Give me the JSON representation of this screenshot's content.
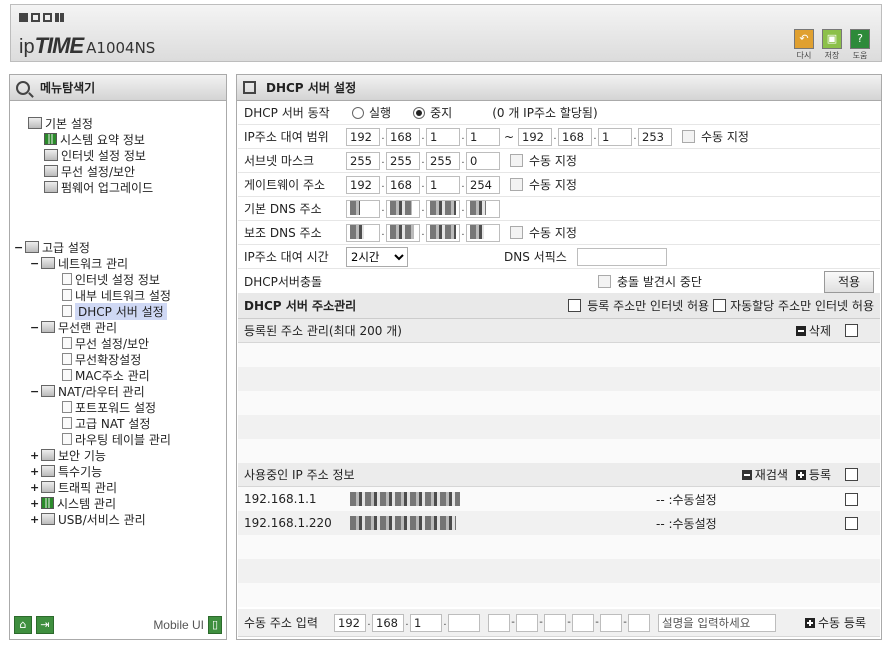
{
  "header": {
    "logo_ip": "ip",
    "logo_time": "TIME",
    "model": "A1004NS",
    "tools": [
      {
        "label": "다시",
        "icon": "undo-icon",
        "color": "#e0a030"
      },
      {
        "label": "저장",
        "icon": "save-icon",
        "color": "#8cc04a"
      },
      {
        "label": "도움",
        "icon": "help-icon",
        "color": "#2d8a3a"
      }
    ]
  },
  "sidebar": {
    "title": "메뉴탐색기",
    "basic": {
      "label": "기본 설정",
      "items": [
        "시스템 요약 정보",
        "인터넷 설정 정보",
        "무선 설정/보안",
        "펌웨어 업그레이드"
      ]
    },
    "advanced": {
      "label": "고급 설정",
      "network": {
        "label": "네트워크 관리",
        "items": [
          "인터넷 설정 정보",
          "내부 네트워크 설정",
          "DHCP 서버 설정"
        ]
      },
      "wireless": {
        "label": "무선랜 관리",
        "items": [
          "무선 설정/보안",
          "무선확장설정",
          "MAC주소 관리"
        ]
      },
      "nat": {
        "label": "NAT/라우터 관리",
        "items": [
          "포트포워드 설정",
          "고급 NAT 설정",
          "라우팅 테이블 관리"
        ]
      },
      "others": [
        "보안 기능",
        "특수기능",
        "트래픽 관리",
        "시스템 관리",
        "USB/서비스 관리"
      ]
    },
    "mobile_label": "Mobile UI"
  },
  "main": {
    "title": "DHCP 서버 설정",
    "server_mode": {
      "label": "DHCP 서버 동작",
      "run": "실행",
      "stop": "중지",
      "note": "(0 개 IP주소 할당됨)",
      "selected": "stop"
    },
    "lease_range": {
      "label": "IP주소 대여 범위",
      "start": [
        "192",
        "168",
        "1",
        "1"
      ],
      "end": [
        "192",
        "168",
        "1",
        "253"
      ],
      "separator": "~",
      "manual": "수동 지정"
    },
    "subnet": {
      "label": "서브넷 마스크",
      "value": [
        "255",
        "255",
        "255",
        "0"
      ],
      "manual": "수동 지정"
    },
    "gateway": {
      "label": "게이트웨이 주소",
      "value": [
        "192",
        "168",
        "1",
        "254"
      ],
      "manual": "수동 지정"
    },
    "dns1": {
      "label": "기본 DNS 주소"
    },
    "dns2": {
      "label": "보조 DNS 주소",
      "manual": "수동 지정"
    },
    "lease_time": {
      "label": "IP주소 대여 시간",
      "value": "2시간",
      "dns_suffix_label": "DNS 서픽스",
      "dns_suffix": ""
    },
    "conflict": {
      "label": "DHCP서버충돌",
      "stop_label": "충돌 발견시 중단",
      "apply": "적용"
    },
    "addr_section": {
      "title": "DHCP 서버 주소관리",
      "opt1": "등록 주소만 인터넷 허용",
      "opt2": "자동할당 주소만 인터넷 허용"
    },
    "registered": {
      "label": "등록된 주소 관리(최대 200 개)",
      "delete": "삭제"
    },
    "in_use": {
      "label": "사용중인 IP 주소 정보",
      "rescan": "재검색",
      "register": "등록",
      "rows": [
        {
          "ip": "192.168.1.1",
          "status": "-- :수동설정"
        },
        {
          "ip": "192.168.1.220",
          "status": "-- :수동설정"
        }
      ]
    },
    "manual_input": {
      "label": "수동 주소 입력",
      "ip": [
        "192",
        "168",
        "1",
        ""
      ],
      "desc_placeholder": "설명을 입력하세요",
      "register": "수동 등록"
    }
  }
}
